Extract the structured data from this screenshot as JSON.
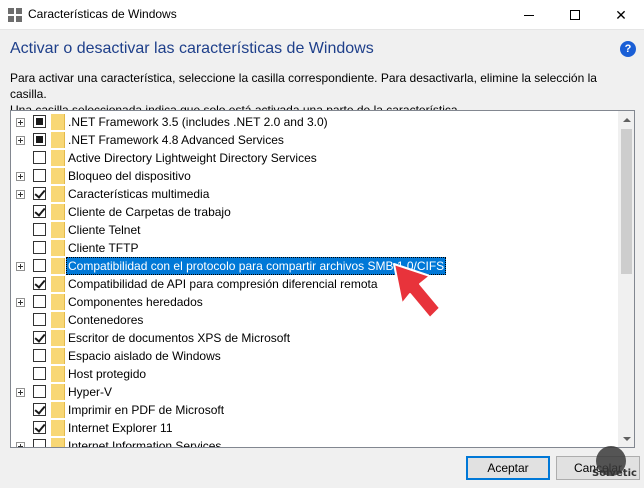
{
  "window": {
    "title": "Características de Windows"
  },
  "header": {
    "title": "Activar o desactivar las características de Windows",
    "help_label": "?",
    "description_line1": "Para activar una característica, seleccione la casilla correspondiente. Para desactivarla, elimine la selección la casilla.",
    "description_line2": "Una casilla seleccionada indica que solo está activada una parte de la característica."
  },
  "features": [
    {
      "label": ".NET Framework 3.5 (includes .NET 2.0 and 3.0)",
      "expandable": true,
      "state": "partial",
      "selected": false
    },
    {
      "label": ".NET Framework 4.8 Advanced Services",
      "expandable": true,
      "state": "partial",
      "selected": false
    },
    {
      "label": "Active Directory Lightweight Directory Services",
      "expandable": false,
      "state": "unchecked",
      "selected": false
    },
    {
      "label": "Bloqueo del dispositivo",
      "expandable": true,
      "state": "unchecked",
      "selected": false
    },
    {
      "label": "Características multimedia",
      "expandable": true,
      "state": "checked",
      "selected": false
    },
    {
      "label": "Cliente de Carpetas de trabajo",
      "expandable": false,
      "state": "checked",
      "selected": false
    },
    {
      "label": "Cliente Telnet",
      "expandable": false,
      "state": "unchecked",
      "selected": false
    },
    {
      "label": "Cliente TFTP",
      "expandable": false,
      "state": "unchecked",
      "selected": false
    },
    {
      "label": "Compatibilidad con el protocolo para compartir archivos SMB 1.0/CIFS",
      "expandable": true,
      "state": "unchecked",
      "selected": true
    },
    {
      "label": "Compatibilidad de API para compresión diferencial remota",
      "expandable": false,
      "state": "checked",
      "selected": false
    },
    {
      "label": "Componentes heredados",
      "expandable": true,
      "state": "unchecked",
      "selected": false
    },
    {
      "label": "Contenedores",
      "expandable": false,
      "state": "unchecked",
      "selected": false
    },
    {
      "label": "Escritor de documentos XPS de Microsoft",
      "expandable": false,
      "state": "checked",
      "selected": false
    },
    {
      "label": "Espacio aislado de Windows",
      "expandable": false,
      "state": "unchecked",
      "selected": false
    },
    {
      "label": "Host protegido",
      "expandable": false,
      "state": "unchecked",
      "selected": false
    },
    {
      "label": "Hyper-V",
      "expandable": true,
      "state": "unchecked",
      "selected": false
    },
    {
      "label": "Imprimir en PDF de Microsoft",
      "expandable": false,
      "state": "checked",
      "selected": false
    },
    {
      "label": "Internet Explorer 11",
      "expandable": false,
      "state": "checked",
      "selected": false
    },
    {
      "label": "Internet Information Services",
      "expandable": true,
      "state": "unchecked",
      "selected": false
    }
  ],
  "footer": {
    "accept_label": "Aceptar",
    "cancel_label": "Cancelar"
  },
  "watermark": {
    "text": "Solvetic"
  },
  "colors": {
    "selection": "#0078d7",
    "header_title": "#1e3f8a",
    "folder": "#f8d775",
    "pointer_arrow": "#e8333b"
  }
}
